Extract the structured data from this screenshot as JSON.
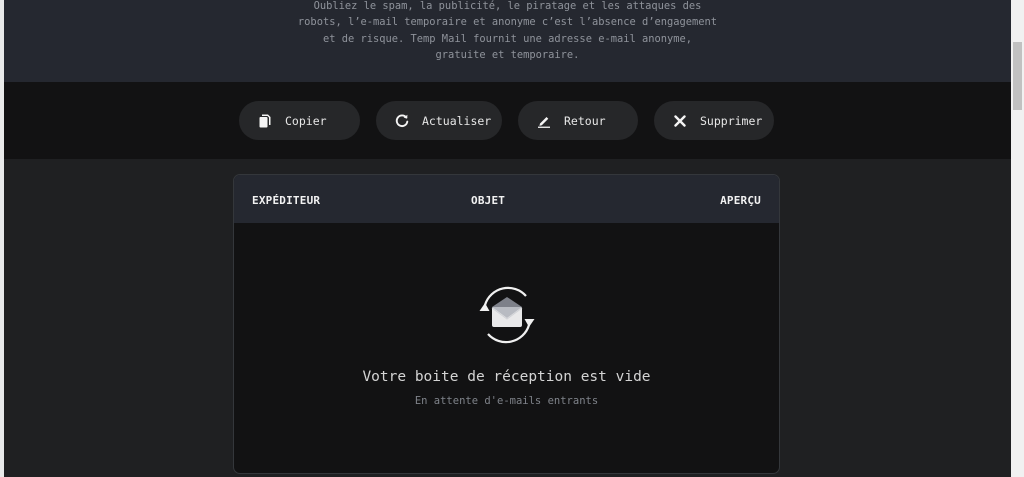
{
  "hero": {
    "line1": "Oubliez le spam, la publicité, le piratage et les attaques des",
    "line2": "robots, l’e-mail temporaire et anonyme c’est l’absence d’engagement",
    "line3": "et de risque. Temp Mail fournit une adresse e-mail anonyme,",
    "line4": "gratuite et temporaire."
  },
  "toolbar": {
    "copy_label": "Copier",
    "refresh_label": "Actualiser",
    "back_label": "Retour",
    "delete_label": "Supprimer"
  },
  "inbox": {
    "columns": [
      "EXPÉDITEUR",
      "OBJET",
      "APERÇU"
    ],
    "empty_title": "Votre boite de réception est vide",
    "empty_subtitle": "En attente d'e-mails entrants"
  },
  "icons": {
    "copy": "copy-icon",
    "refresh": "refresh-icon",
    "back": "pen-icon",
    "delete": "close-icon",
    "empty": "envelope-refresh-icon"
  },
  "colors": {
    "page_bg": "#1f2022",
    "hero_bg": "#252830",
    "toolbar_bg": "#121213",
    "button_bg": "#262729",
    "accent_line": "#2aa88a"
  }
}
